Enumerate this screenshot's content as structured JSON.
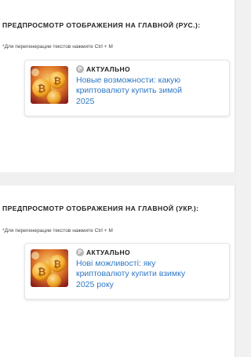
{
  "preview_ru": {
    "title": "ПРЕДПРОСМОТР ОТОБРАЖЕНИЯ НА ГЛАВНОЙ (РУС.):",
    "hint": "*Для перегенерации текстов нажмите Ctrl + M",
    "card": {
      "badge_icon": "P",
      "badge_label": "АКТУАЛЬНО",
      "headline": "Новые возможности: какую криптовалюту купить зимой 2025"
    }
  },
  "preview_uk": {
    "title": "ПРЕДПРОСМОТР ОТОБРАЖЕНИЯ НА ГЛАВНОЙ (УКР.):",
    "hint": "*Для перегенерации текстов нажмите Ctrl + M",
    "card": {
      "badge_icon": "P",
      "badge_label": "АКТУАЛЬНО",
      "headline": "Нові можливості: яку криптовалюту купити взимку 2025 року"
    }
  },
  "colors": {
    "link": "#2f78c4",
    "badge": "#b7b7b7",
    "page_bg": "#f1f1f1"
  },
  "icons": {
    "thumbnail": "bitcoin-coins-thumbnail",
    "badge": "pin-badge-icon"
  }
}
